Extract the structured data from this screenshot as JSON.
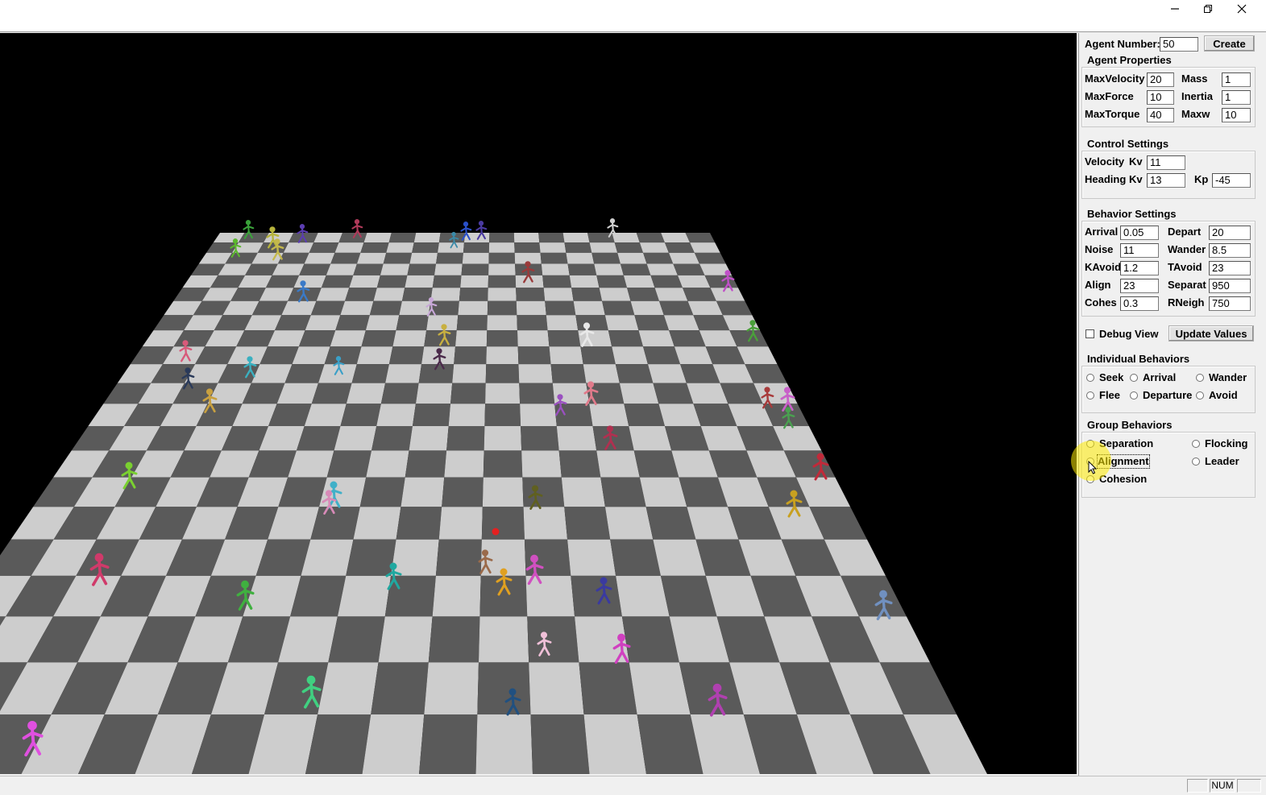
{
  "window": {
    "minimize_icon": "minimize-icon",
    "restore_icon": "restore-icon",
    "close_icon": "close-icon"
  },
  "scene": {
    "floor_light": "#cdcdcd",
    "floor_dark": "#5a5a5a",
    "target_color": "#e52020",
    "background": "#000000"
  },
  "panel": {
    "agent_number": {
      "label": "Agent Number:",
      "value": "50",
      "button": "Create"
    },
    "agent_properties": {
      "title": "Agent Properties",
      "fields": [
        {
          "label": "MaxVelocity",
          "value": "20"
        },
        {
          "label": "Mass",
          "value": "1"
        },
        {
          "label": "MaxForce",
          "value": "10"
        },
        {
          "label": "Inertia",
          "value": "1"
        },
        {
          "label": "MaxTorque",
          "value": "40"
        },
        {
          "label": "Maxw",
          "value": "10"
        }
      ]
    },
    "control_settings": {
      "title": "Control Settings",
      "velocity_label": "Velocity",
      "velocity_kv_label": "Kv",
      "velocity_kv": "11",
      "heading_label": "Heading",
      "heading_kv_label": "Kv",
      "heading_kv": "13",
      "kp_label": "Kp",
      "kp": "-45"
    },
    "behavior_settings": {
      "title": "Behavior Settings",
      "fields": [
        {
          "label": "Arrival",
          "value": "0.05"
        },
        {
          "label": "Depart",
          "value": "20"
        },
        {
          "label": "Noise",
          "value": "11"
        },
        {
          "label": "Wander",
          "value": "8.5"
        },
        {
          "label": "KAvoid",
          "value": "1.2"
        },
        {
          "label": "TAvoid",
          "value": "23"
        },
        {
          "label": "Align",
          "value": "23"
        },
        {
          "label": "Separat",
          "value": "950"
        },
        {
          "label": "Cohes",
          "value": "0.3"
        },
        {
          "label": "RNeigh",
          "value": "750"
        }
      ]
    },
    "debug_view": {
      "label": "Debug View",
      "checked": false
    },
    "update_button": "Update Values",
    "individual_behaviors": {
      "title": "Individual Behaviors",
      "options": [
        "Seek",
        "Arrival",
        "Wander",
        "Flee",
        "Departure",
        "Avoid"
      ]
    },
    "group_behaviors": {
      "title": "Group Behaviors",
      "options": [
        "Separation",
        "Flocking",
        "Alignment",
        "Leader",
        "Cohesion"
      ]
    }
  },
  "statusbar": {
    "num": "NUM"
  }
}
